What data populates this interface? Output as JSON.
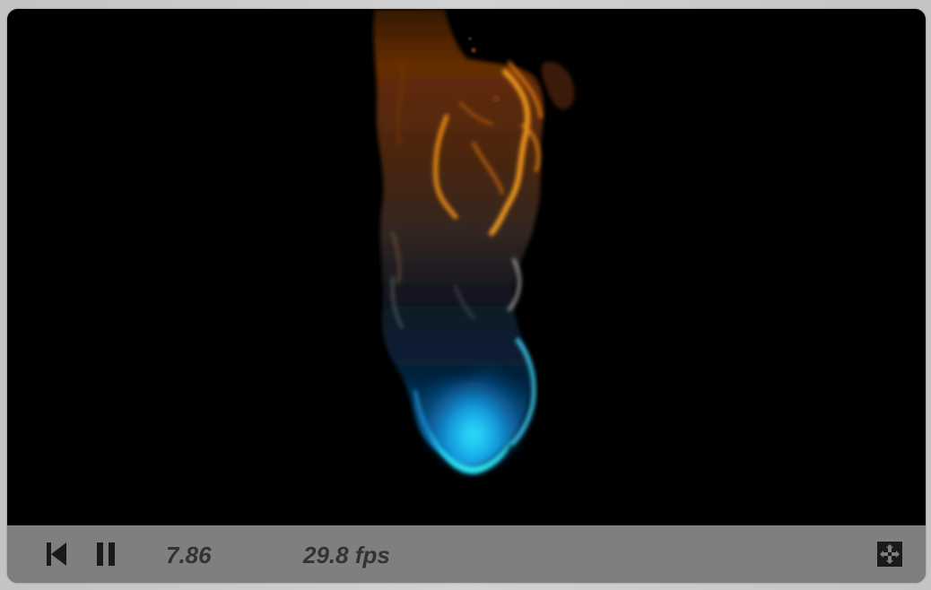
{
  "player": {
    "time": "7.86",
    "fps": "29.8 fps",
    "controls": {
      "restart_icon": "skip-to-start-icon",
      "pause_icon": "pause-icon",
      "fullscreen_icon": "fullscreen-icon"
    }
  },
  "colors": {
    "canvas_background": "#000000",
    "control_bar": "#7f7f7f",
    "control_text": "#333333",
    "icon_color": "#1a1a1a",
    "flame_orange": "#ff9a1a",
    "flame_blue": "#19c8ff",
    "flame_white": "#d9d4d0"
  }
}
